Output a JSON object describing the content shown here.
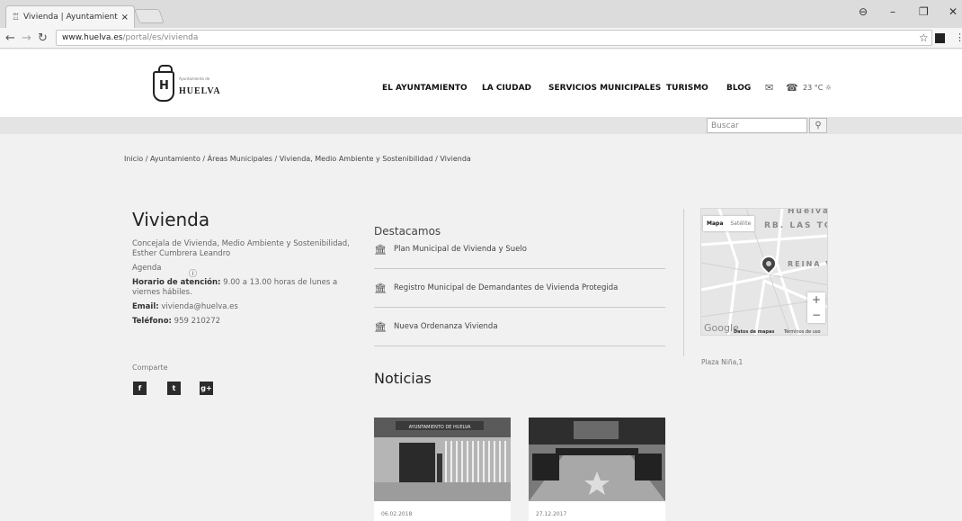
{
  "browser": {
    "tab_title": "Vivienda | Ayuntamiento",
    "tab_close": "×",
    "url_host": "www.huelva.es",
    "url_path": "/portal/es/vivienda"
  },
  "logo": {
    "small_text": "Ayuntamiento de",
    "name": "HUELVA"
  },
  "nav": {
    "items": [
      "EL AYUNTAMIENTO",
      "LA CIUDAD",
      "SERVICIOS MUNICIPALES",
      "TURISMO",
      "BLOG"
    ],
    "weather": "23 °C"
  },
  "search": {
    "placeholder": "Buscar"
  },
  "breadcrumb": {
    "items": [
      "Inicio",
      "Ayuntamiento",
      "Áreas Municipales",
      "Vivienda, Medio Ambiente y Sostenibilidad",
      "Vivienda"
    ],
    "separator": " / "
  },
  "page": {
    "title": "Vivienda",
    "concejala": "Concejala de Vivienda, Medio Ambiente y Sostenibilidad, Esther Cumbrera Leandro",
    "agenda": "Agenda",
    "horario_label": "Horario de atención:",
    "horario_value": " 9.00 a 13.00 horas de lunes a viernes hábiles.",
    "email_label": "Email:",
    "email_value": " vivienda@huelva.es",
    "telefono_label": "Teléfono:",
    "telefono_value": " 959 210272",
    "share_label": "Comparte",
    "social": [
      "f",
      "t",
      "g+"
    ]
  },
  "destacamos": {
    "title": "Destacamos",
    "items": [
      "Plan Municipal de Vivienda y Suelo",
      "Registro Municipal de Demandantes de Vivienda Protegida",
      "Nueva Ordenanza Vivienda"
    ]
  },
  "noticias": {
    "title": "Noticias",
    "items": [
      {
        "date": "06.02.2018",
        "sign": "AYUNTAMIENTO DE HUELVA"
      },
      {
        "date": "27.12.2017"
      }
    ]
  },
  "map": {
    "tab_map": "Mapa",
    "tab_satellite": "Satélite",
    "label_top": "Huelva",
    "label_barrio": "RB. LAS TO",
    "label_reina": "REINA V",
    "google": "Google",
    "copyright": "Datos de mapas",
    "terms": "Términos de uso",
    "address": "Plaza Niña,1"
  }
}
